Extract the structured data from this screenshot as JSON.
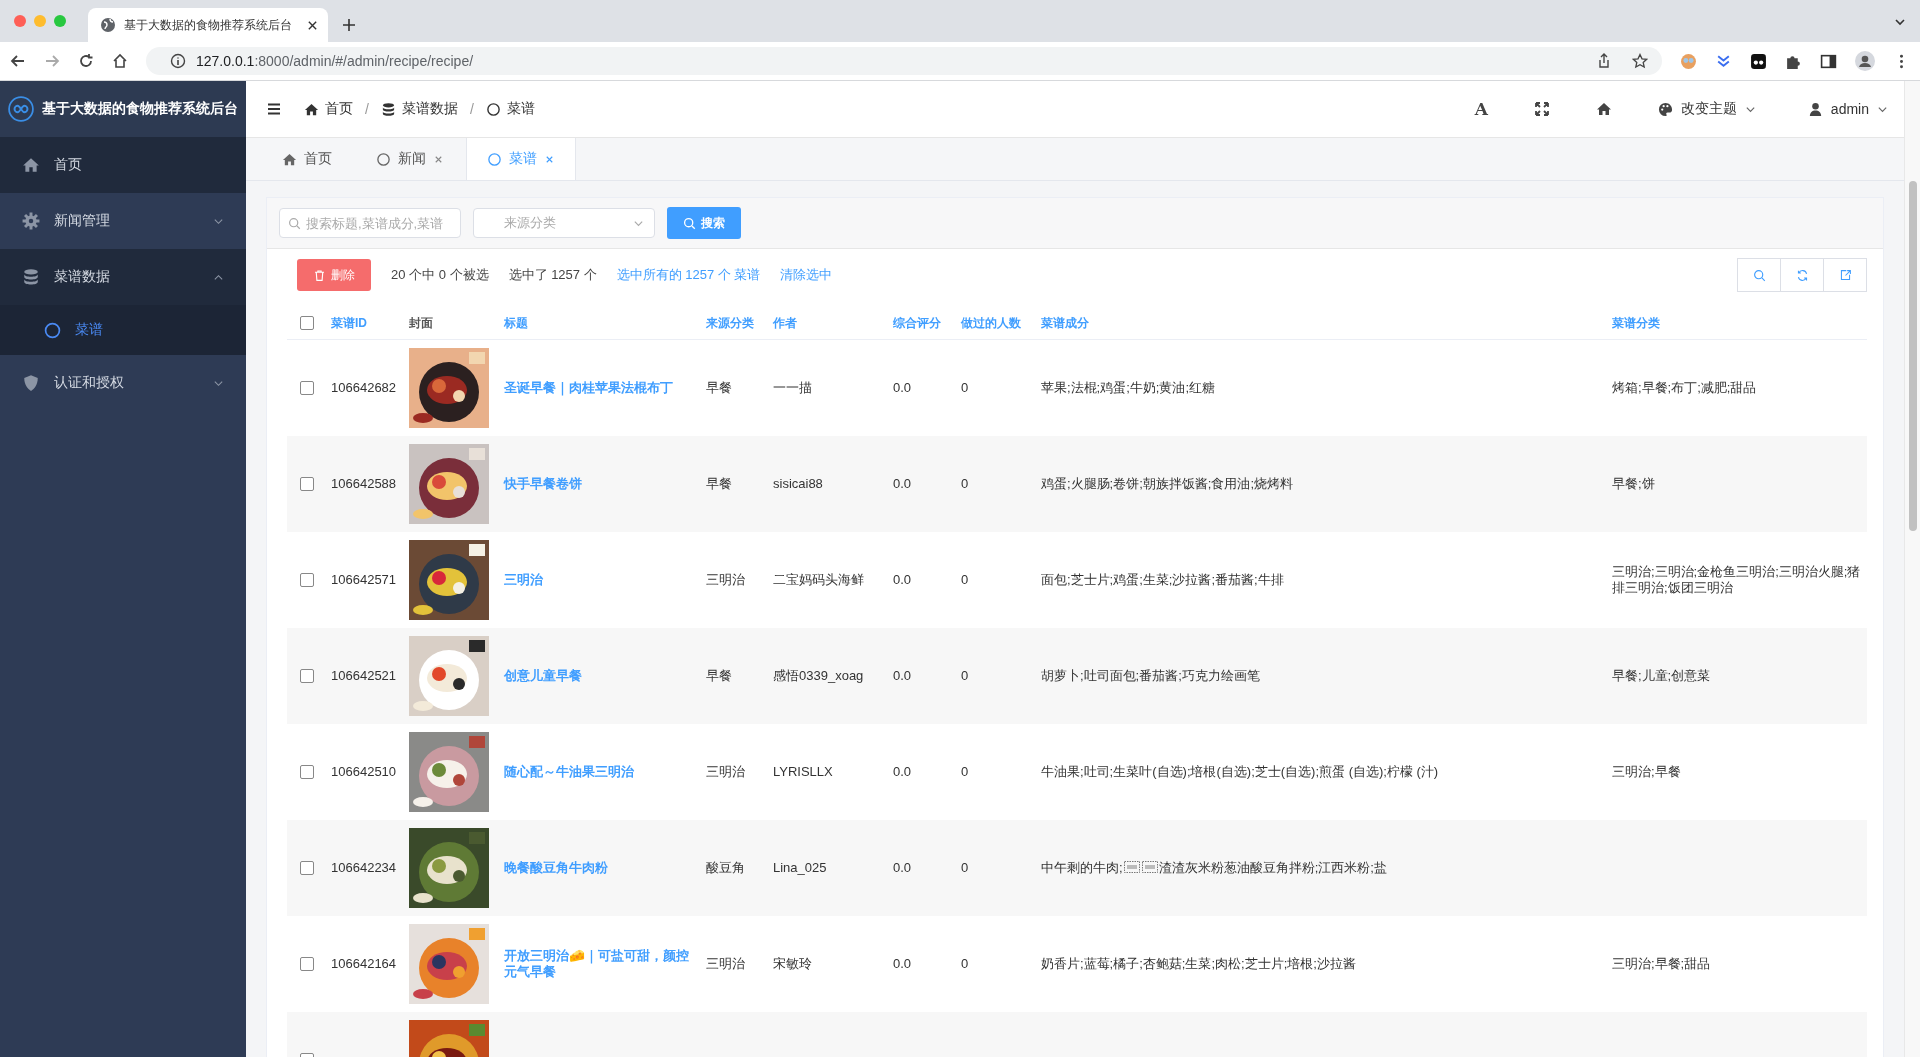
{
  "browser": {
    "tab_title": "基于大数据的食物推荐系统后台",
    "url_host": "127.0.0.1",
    "url_path": ":8000/admin/#/admin/recipe/recipe/"
  },
  "app": {
    "title": "基于大数据的食物推荐系统后台"
  },
  "sidebar": {
    "items": [
      {
        "label": "首页",
        "selected": false
      },
      {
        "label": "新闻管理",
        "selected": false,
        "expanded": false
      },
      {
        "label": "菜谱数据",
        "selected": false,
        "expanded": true,
        "children": [
          {
            "label": "菜谱",
            "selected": true
          }
        ]
      },
      {
        "label": "认证和授权",
        "selected": false,
        "expanded": false
      }
    ]
  },
  "header": {
    "breadcrumb": [
      "首页",
      "菜谱数据",
      "菜谱"
    ],
    "breadcrumb_separators": [
      "/",
      "/"
    ],
    "font_button": "A",
    "theme_label": "改变主题",
    "user": "admin"
  },
  "tabs": [
    {
      "label": "首页",
      "selected": false,
      "closable": false
    },
    {
      "label": "新闻",
      "selected": false,
      "closable": true
    },
    {
      "label": "菜谱",
      "selected": true,
      "closable": true
    }
  ],
  "filters": {
    "search_placeholder": "搜索标题,菜谱成分,菜谱",
    "source_placeholder": "来源分类",
    "search_button": "搜索"
  },
  "actions": {
    "delete_button": "删除",
    "selection_count": "20 个中 0 个被选",
    "selected_total": "选中了 1257 个",
    "select_all_link": "选中所有的 1257 个 菜谱",
    "clear_link": "清除选中"
  },
  "table": {
    "all_checked": false,
    "columns": [
      "菜谱ID",
      "封面",
      "标题",
      "来源分类",
      "作者",
      "综合评分",
      "做过的人数",
      "菜谱成分",
      "菜谱分类"
    ],
    "rows": [
      {
        "checked": false,
        "id": "106642682",
        "title": "圣诞早餐｜肉桂苹果法棍布丁",
        "source": "早餐",
        "author": "一一描",
        "score": "0.0",
        "made": "0",
        "ingredients": "苹果;法棍;鸡蛋;牛奶;黄油;红糖",
        "categories": "烤箱;早餐;布丁;减肥;甜品"
      },
      {
        "checked": false,
        "id": "106642588",
        "title": "快手早餐卷饼",
        "source": "早餐",
        "author": "sisicai88",
        "score": "0.0",
        "made": "0",
        "ingredients": "鸡蛋;火腿肠;卷饼;朝族拌饭酱;食用油;烧烤料",
        "categories": "早餐;饼"
      },
      {
        "checked": false,
        "id": "106642571",
        "title": "三明治",
        "source": "三明治",
        "author": "二宝妈码头海鲜",
        "score": "0.0",
        "made": "0",
        "ingredients": "面包;芝士片;鸡蛋;生菜;沙拉酱;番茄酱;牛排",
        "categories": "三明治;三明治;金枪鱼三明治;三明治火腿;猪排三明治;饭团三明治"
      },
      {
        "checked": false,
        "id": "106642521",
        "title": "创意儿童早餐",
        "source": "早餐",
        "author": "感悟0339_xoag",
        "score": "0.0",
        "made": "0",
        "ingredients": "胡萝卜;吐司面包;番茄酱;巧克力绘画笔",
        "categories": "早餐;儿童;创意菜"
      },
      {
        "checked": false,
        "id": "106642510",
        "title": "随心配～牛油果三明治",
        "source": "三明治",
        "author": "LYRISLLX",
        "score": "0.0",
        "made": "0",
        "ingredients": "牛油果;吐司;生菜叶(自选);培根(自选);芝士(自选);煎蛋 (自选);柠檬 (汁)",
        "categories": "三明治;早餐"
      },
      {
        "checked": false,
        "id": "106642234",
        "title": "晚餐酸豆角牛肉粉",
        "source": "酸豆角",
        "author": "Lina_025",
        "score": "0.0",
        "made": "0",
        "ingredients": "中午剩的牛肉;",
        "ingredients_after_objects": "渣渣灰米粉葱油酸豆角拌粉;江西米粉;盐"
      },
      {
        "checked": false,
        "id": "106642164",
        "title": "开放三明治🧀｜可盐可甜，颜控元气早餐",
        "source": "三明治",
        "author": "宋敏玲",
        "score": "0.0",
        "made": "0",
        "ingredients": "奶香片;蓝莓;橘子;杏鲍菇;生菜;肉松;芝士片;培根;沙拉酱",
        "categories": "三明治;早餐;甜品"
      },
      {
        "checked": false
      }
    ]
  }
}
